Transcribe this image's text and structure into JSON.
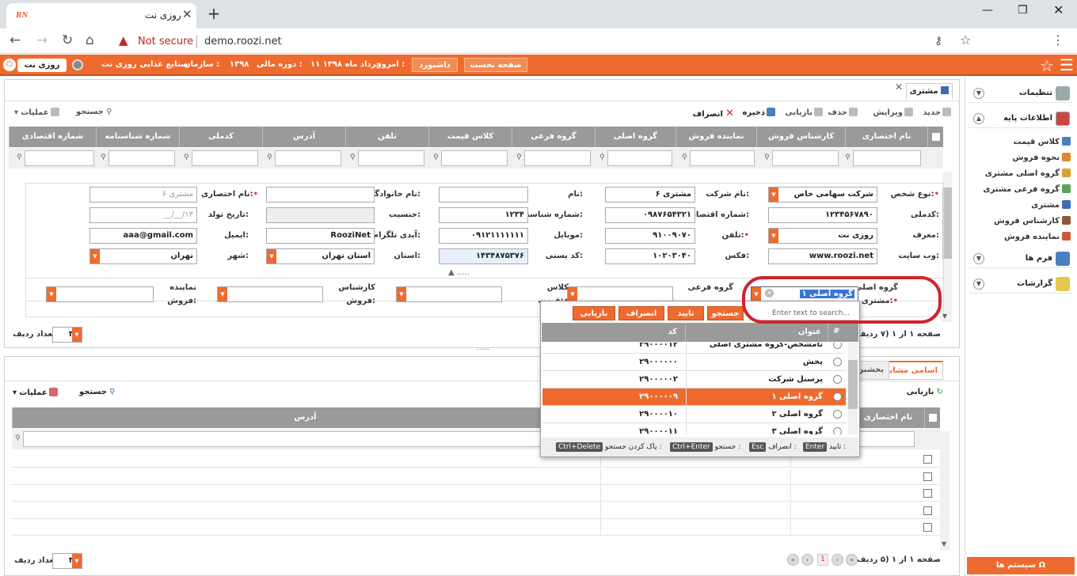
{
  "browser": {
    "tab_title": "روزی نت",
    "favicon": "RN",
    "url": "demo.roozi.net",
    "not_secure": "Not secure"
  },
  "header": {
    "user": "روزی نت",
    "org_label": "سازمان :",
    "org": "صنایع غذایی روزی نت",
    "period_label": "دوره مالی :",
    "period": "۱۳۹۸",
    "today_label": "امروز :",
    "today": "۱۱ خرداد ماه ۱۳۹۸",
    "dashboard": "داشبورد",
    "home": "صفحه نخست"
  },
  "sidebar": {
    "settings": "تنظیمات",
    "base_info": "اطلاعات پایه",
    "items": [
      "کلاس قیمت",
      "نحوه فروش",
      "گروه اصلی مشتری",
      "گروه فرعی مشتری",
      "مشتری",
      "کارشناس فروش",
      "نماینده فروش"
    ],
    "forms": "فرم ها",
    "reports": "گزارشات",
    "system": "سیستم ها"
  },
  "page": {
    "tab": "مشتری"
  },
  "toolbar": {
    "new": "جدید",
    "edit": "ویرایش",
    "delete": "حذف",
    "reload": "بازیابی",
    "save": "ذخیره",
    "cancel": "انصراف",
    "search": "جستجو",
    "actions": "عملیات"
  },
  "grid": {
    "headers": [
      "نام اختصاری",
      "کارشناس فروش",
      "نماینده فروش",
      "گروه اصلی",
      "گروه فرعی",
      "کلاس قیمت",
      "تلفن",
      "آدرس",
      "کدملی",
      "شماره شناسنامه",
      "شماره اقتصادی"
    ]
  },
  "form": {
    "person_type_l": "نوع شخص:",
    "person_type": "شرکت سهامی خاص",
    "company_l": "نام شرکت:",
    "company": "مشتری ۶",
    "name_l": "نام:",
    "family_l": "نام خانوادگی:",
    "short_l": "نام اختصاری:",
    "short_ph": "مشتری ۶",
    "nid_l": "کدملی:",
    "nid": "۱۲۳۴۵۶۷۸۹۰",
    "econ_l": "شماره اقتصادی:",
    "econ": "۰۹۸۷۶۵۴۳۲۱",
    "bc_l": "شماره شناسنامه:",
    "bc": "۱۲۳۴",
    "gender_l": "جنسیت:",
    "birth_l": "تاریخ تولد:",
    "birth_ph": "__/__/۱۳",
    "ref_l": "معرف:",
    "ref": "روزی نت",
    "phone_l": "تلفن:",
    "phone": "۹۱۰۰۹۰۷۰",
    "mobile_l": "موبایل:",
    "mobile": "۰۹۱۲۱۱۱۱۱۱۱",
    "telegram_l": "آیدی تلگرام:",
    "telegram": "RooziNet",
    "email_l": "ایمیل:",
    "email": "aaa@gmail.com",
    "web_l": "وب سایت:",
    "web": "www.roozi.net",
    "fax_l": "فکس:",
    "fax": "۱۰۲۰۳۰۴۰",
    "postal_l": "کد پستی:",
    "postal": "۱۴۳۴۸۷۵۳۷۶",
    "province_l": "استان:",
    "province": "استان تهران",
    "city_l": "شهر:",
    "city": "تهران",
    "main_group_l": "گروه اصلی",
    "customer_l": "مشتری:",
    "main_group": "گروه اصلی ۱",
    "sub_group_l": "گروه فرعی",
    "price_class_l": "کلاس",
    "price_class_l2": "قیمت:",
    "sales_exp_l": "کارشناس",
    "sales_exp_l2": "فروش:",
    "sales_rep_l": "نماینده",
    "sales_rep_l2": "فروش:"
  },
  "pager1": {
    "text": "صفحه ۱ از ۱ (۷ ردیف)",
    "rows_label": "تعداد ردیف",
    "rows": "۳۰"
  },
  "popup": {
    "search": "جستجو",
    "confirm": "تایید",
    "cancel": "انصراف",
    "reload": "بازیابی",
    "placeholder": "Enter text to search...",
    "col_hash": "#",
    "col_title": "عنوان",
    "col_code": "کد",
    "rows": [
      {
        "title": "نامشخص-گروه مشتری اصلی",
        "code": "۲۹۰۰۰۰۱۲"
      },
      {
        "title": "پخش",
        "code": "۲۹۰۰۰۰۰۰"
      },
      {
        "title": "پرسنل شرکت",
        "code": "۲۹۰۰۰۰۰۲"
      },
      {
        "title": "گروه اصلی ۱",
        "code": "۲۹۰۰۰۰۰۹"
      },
      {
        "title": "گروه اصلی ۲",
        "code": "۲۹۰۰۰۰۱۰"
      },
      {
        "title": "گروه اصلی ۳",
        "code": "۲۹۰۰۰۰۱۱"
      }
    ],
    "hint_confirm": "تایید :",
    "hint_cancel": "انصراف :",
    "hint_search": "جستجو :",
    "hint_clear": "پاک کردن جستجو :",
    "k_enter": "Enter",
    "k_esc": "Esc",
    "k_ctrl_enter": "Ctrl+Enter",
    "k_ctrl_delete": "Ctrl+Delete"
  },
  "bottom": {
    "tab_similar": "اسامی مشابه",
    "tab_other": "بخشبن",
    "reload": "بازیابی",
    "search": "جستجو",
    "actions": "عملیات",
    "col_name": "نام اختصاری",
    "col_address": "آدرس",
    "rows": "۳۰",
    "pager": "صفحه ۱ از ۱ (۵ ردیف)",
    "page_num": "1",
    "rows_label": "تعداد ردیف"
  }
}
